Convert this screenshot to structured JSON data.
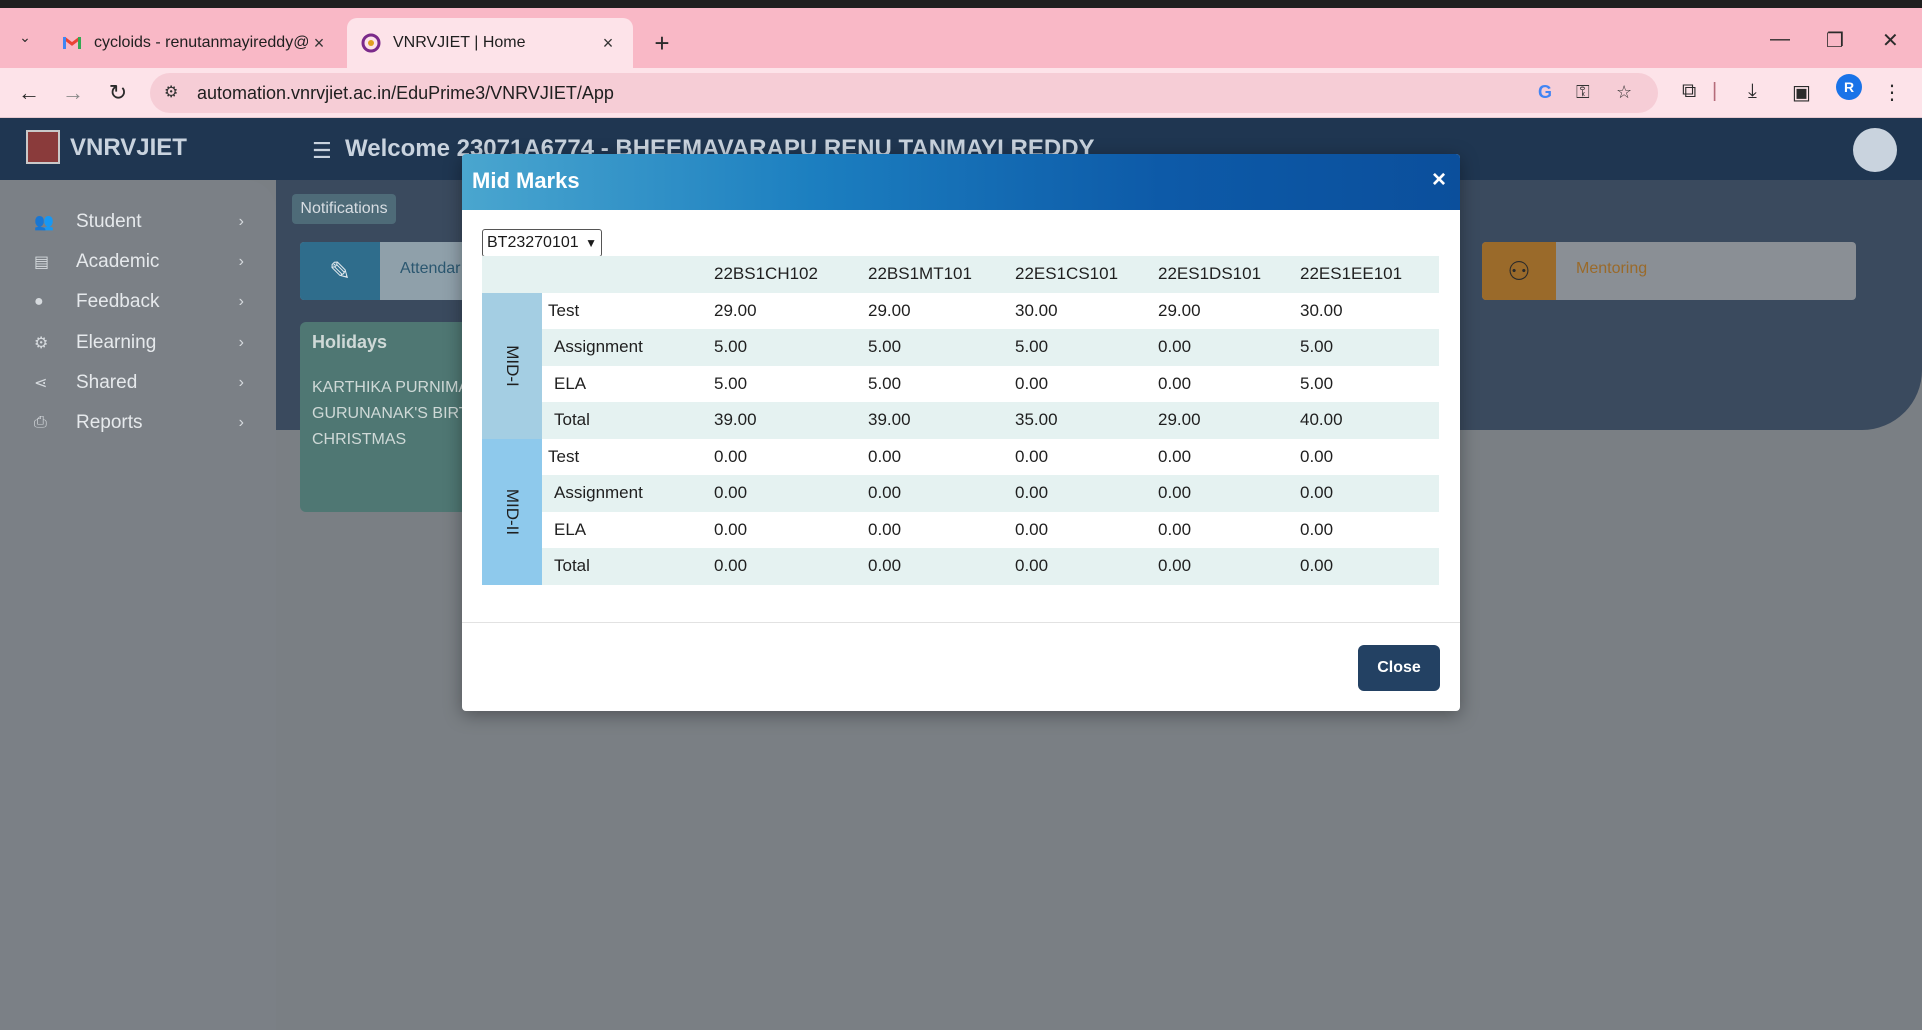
{
  "browser": {
    "tabs": [
      {
        "title": "cycloids - renutanmayireddy@",
        "active": false
      },
      {
        "title": "VNRVJIET | Home",
        "active": true
      }
    ],
    "url": "automation.vnrvjiet.ac.in/EduPrime3/VNRVJIET/App",
    "profile_initial": "R"
  },
  "app": {
    "brand": "VNRVJIET",
    "welcome": "Welcome 23071A6774 - BHEEMAVARAPU RENU TANMAYI REDDY",
    "sidebar": [
      {
        "label": "Student",
        "icon": "users-icon"
      },
      {
        "label": "Academic",
        "icon": "book-icon"
      },
      {
        "label": "Feedback",
        "icon": "user-icon"
      },
      {
        "label": "Elearning",
        "icon": "cogs-icon"
      },
      {
        "label": "Shared",
        "icon": "share-icon"
      },
      {
        "label": "Reports",
        "icon": "print-icon"
      }
    ],
    "notifications_label": "Notifications",
    "attendance_label": "Attendar",
    "mentoring_label": "Mentoring",
    "holidays": {
      "title": "Holidays",
      "items": [
        "KARTHIKA PURNIMA",
        "GURUNANAK'S BIRT",
        "CHRISTMAS"
      ]
    }
  },
  "modal": {
    "title": "Mid Marks",
    "selected_code": "BT23270101",
    "columns": [
      "22BS1CH102",
      "22BS1MT101",
      "22ES1CS101",
      "22ES1DS101",
      "22ES1EE101"
    ],
    "groups": [
      {
        "name": "MID-I",
        "rows": [
          {
            "label": "Test",
            "values": [
              "29.00",
              "29.00",
              "30.00",
              "29.00",
              "30.00"
            ]
          },
          {
            "label": "Assignment",
            "values": [
              "5.00",
              "5.00",
              "5.00",
              "0.00",
              "5.00"
            ]
          },
          {
            "label": "ELA",
            "values": [
              "5.00",
              "5.00",
              "0.00",
              "0.00",
              "5.00"
            ]
          },
          {
            "label": "Total",
            "values": [
              "39.00",
              "39.00",
              "35.00",
              "29.00",
              "40.00"
            ]
          }
        ]
      },
      {
        "name": "MID-II",
        "rows": [
          {
            "label": "Test",
            "values": [
              "0.00",
              "0.00",
              "0.00",
              "0.00",
              "0.00"
            ]
          },
          {
            "label": "Assignment",
            "values": [
              "0.00",
              "0.00",
              "0.00",
              "0.00",
              "0.00"
            ]
          },
          {
            "label": "ELA",
            "values": [
              "0.00",
              "0.00",
              "0.00",
              "0.00",
              "0.00"
            ]
          },
          {
            "label": "Total",
            "values": [
              "0.00",
              "0.00",
              "0.00",
              "0.00",
              "0.00"
            ]
          }
        ]
      }
    ],
    "close_label": "Close",
    "close_x": "×"
  },
  "colors": {
    "tabbar": "#f9b8c6",
    "modal_header": "#0d5aa8",
    "close_button": "#234163",
    "row_stripe": "#e5f2f1"
  }
}
